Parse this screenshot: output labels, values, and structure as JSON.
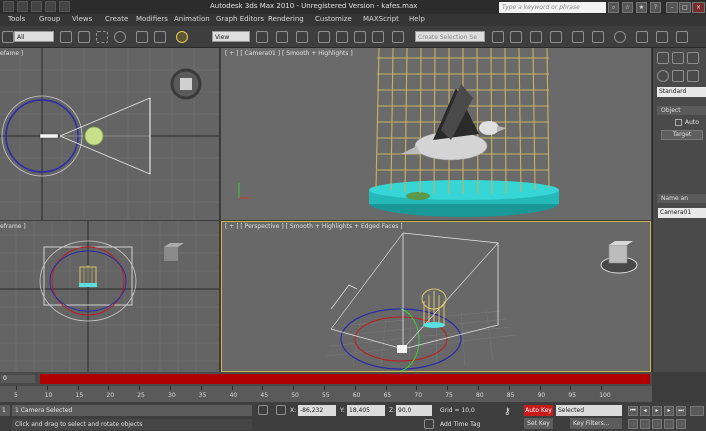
{
  "titlebar": {
    "title": "Autodesk 3ds Max  2010    - Unregistered Version -    kafes.max",
    "search_placeholder": "Type a keyword or phrase"
  },
  "menu": {
    "items": [
      "Tools",
      "Group",
      "Views",
      "Create",
      "Modifiers",
      "Animation",
      "Graph Editors",
      "Rendering",
      "Customize",
      "MAXScript",
      "Help"
    ]
  },
  "toolbar": {
    "filter_value": "All",
    "coord_value": "View",
    "selection_set_placeholder": "Create Selection Se"
  },
  "viewports": {
    "top_left_label": "efame ]",
    "camera_label": "[ + ] [ Camera01 ] [ Smooth + Highlights ]",
    "bottom_left_label": "eframe ]",
    "perspective_label": "[ + ] [ Perspective ] [ Smooth + Highlights + Edged Faces ]"
  },
  "command_panel": {
    "category_value": "Standard",
    "object_type_rollout": "Object",
    "autogrid_label": "Auto",
    "target_button": "Target",
    "name_rollout": "Name an",
    "name_value": "Camera01"
  },
  "timeline": {
    "frame_label": "0",
    "ruler_labels": [
      "5",
      "10",
      "15",
      "20",
      "25",
      "30",
      "35",
      "40",
      "45",
      "50",
      "55",
      "60",
      "65",
      "70",
      "75",
      "80",
      "85",
      "90",
      "95",
      "100"
    ]
  },
  "status": {
    "selection_count": "1",
    "selection_text": "1 Camera Selected",
    "prompt_text": "Click and drag to select and rotate objects",
    "x_label": "X:",
    "x_value": "-86,232",
    "y_label": "Y:",
    "y_value": "18,405",
    "z_label": "Z:",
    "z_value": "90,0",
    "grid_text": "Grid = 10,0",
    "add_time_tag": "Add Time Tag",
    "auto_key": "Auto Key",
    "set_key": "Set Key",
    "key_mode_value": "Selected",
    "key_filters": "Key Filters..."
  }
}
